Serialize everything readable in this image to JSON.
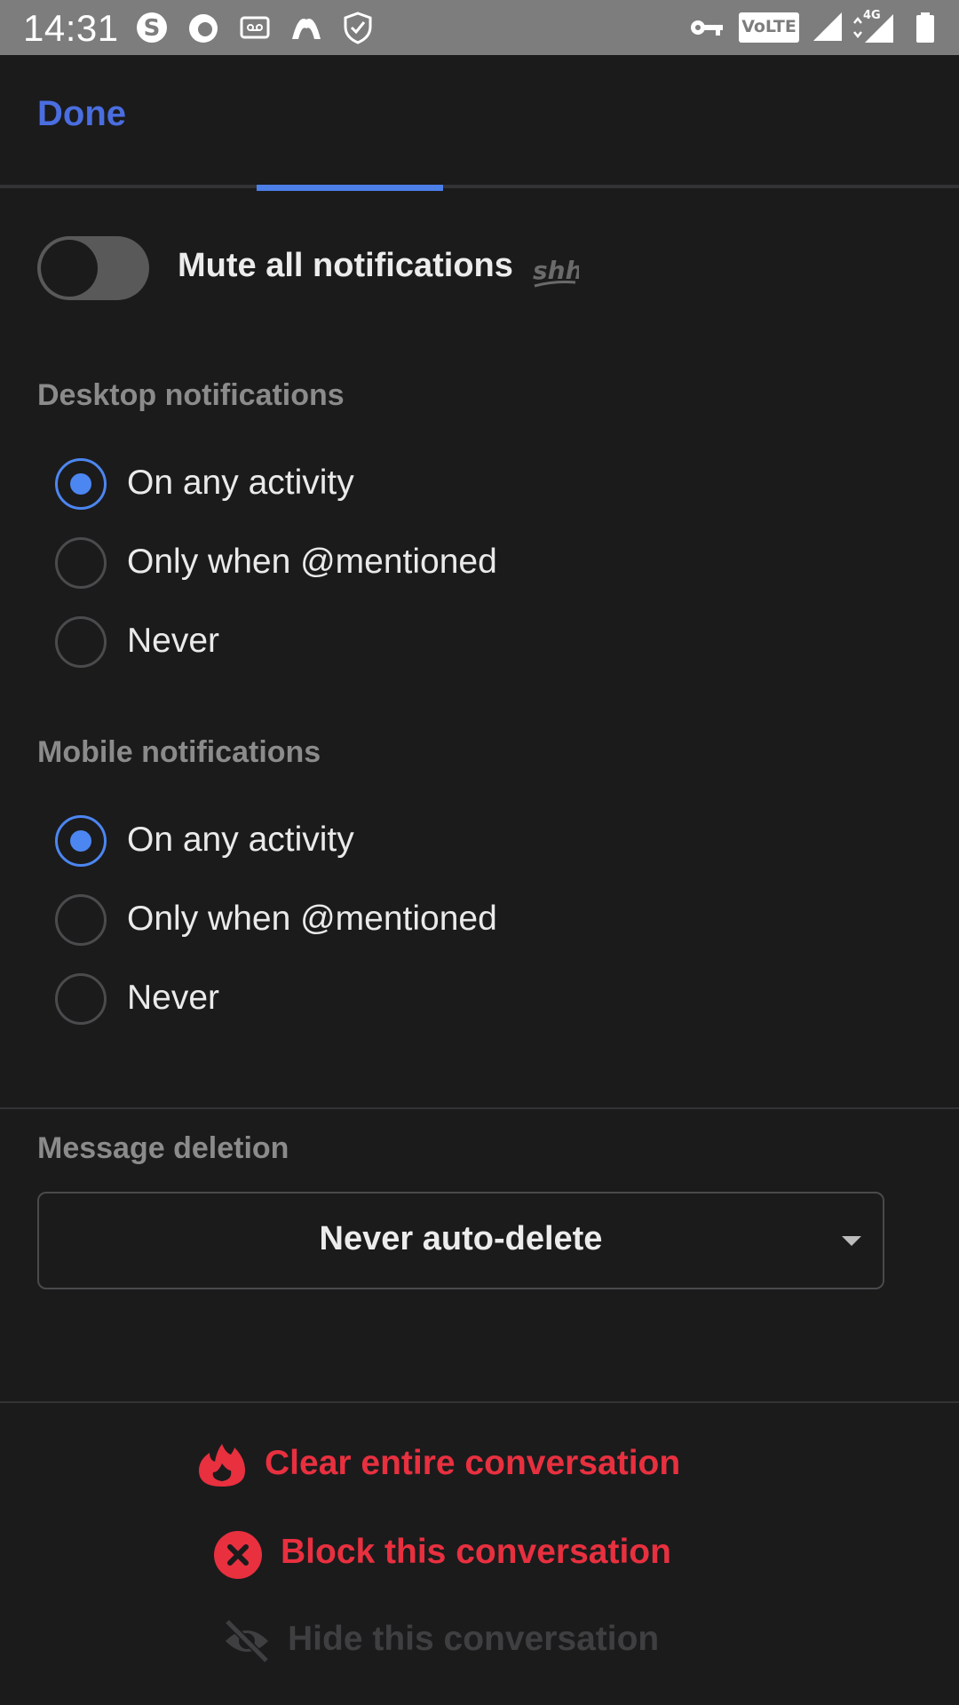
{
  "status_bar": {
    "time": "14:31",
    "volte": "VoLTE",
    "network": "4G"
  },
  "header": {
    "done_label": "Done"
  },
  "mute": {
    "label": "Mute all notifications",
    "badge": "shh",
    "enabled": false
  },
  "desktop": {
    "heading": "Desktop notifications",
    "options": [
      "On any activity",
      "Only when @mentioned",
      "Never"
    ],
    "selected": "On any activity"
  },
  "mobile": {
    "heading": "Mobile notifications",
    "options": [
      "On any activity",
      "Only when @mentioned",
      "Never"
    ],
    "selected": "On any activity"
  },
  "deletion": {
    "heading": "Message deletion",
    "value": "Never auto-delete"
  },
  "actions": {
    "clear": "Clear entire conversation",
    "block": "Block this conversation",
    "hide": "Hide this conversation"
  },
  "colors": {
    "accent": "#4c86f0",
    "danger": "#e8303f",
    "background": "#1b1b1c"
  }
}
